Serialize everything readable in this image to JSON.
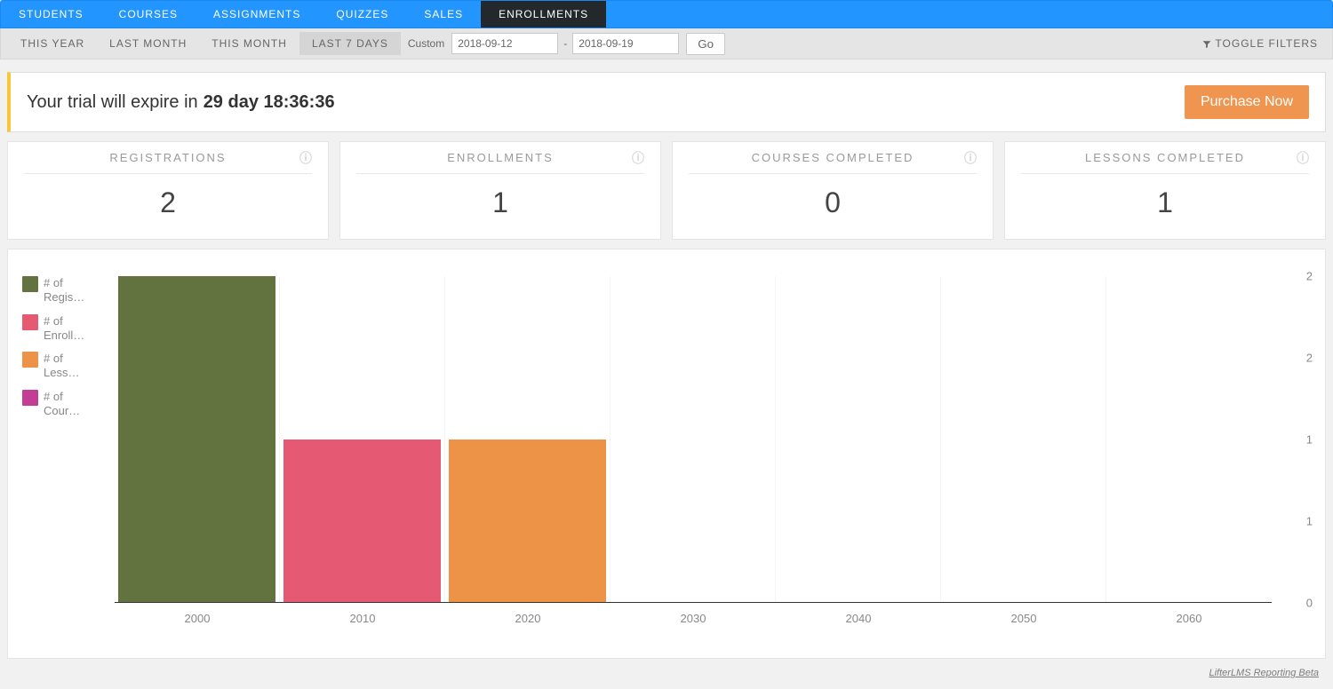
{
  "nav": {
    "tabs": [
      {
        "label": "STUDENTS",
        "active": false
      },
      {
        "label": "COURSES",
        "active": false
      },
      {
        "label": "ASSIGNMENTS",
        "active": false
      },
      {
        "label": "QUIZZES",
        "active": false
      },
      {
        "label": "SALES",
        "active": false
      },
      {
        "label": "ENROLLMENTS",
        "active": true
      }
    ]
  },
  "subbar": {
    "ranges": [
      {
        "label": "THIS YEAR",
        "active": false
      },
      {
        "label": "LAST MONTH",
        "active": false
      },
      {
        "label": "THIS MONTH",
        "active": false
      },
      {
        "label": "LAST 7 DAYS",
        "active": true
      }
    ],
    "custom_label": "Custom",
    "date_from": "2018-09-12",
    "date_to": "2018-09-19",
    "go_label": "Go",
    "toggle_filters_label": "TOGGLE FILTERS"
  },
  "trial": {
    "prefix": "Your trial will expire in",
    "countdown": "29 day 18:36:36",
    "purchase_label": "Purchase Now"
  },
  "stats": [
    {
      "title": "REGISTRATIONS",
      "value": "2"
    },
    {
      "title": "ENROLLMENTS",
      "value": "1"
    },
    {
      "title": "COURSES COMPLETED",
      "value": "0"
    },
    {
      "title": "LESSONS COMPLETED",
      "value": "1"
    }
  ],
  "chart_data": {
    "type": "bar",
    "series": [
      {
        "name": "# of\nRegis…",
        "legend_full": "# of Registrations",
        "color": "#62733f"
      },
      {
        "name": "# of\nEnroll…",
        "legend_full": "# of Enrollments",
        "color": "#e55973"
      },
      {
        "name": "# of\nLess…",
        "legend_full": "# of Lessons",
        "color": "#ed9348"
      },
      {
        "name": "# of\nCour…",
        "legend_full": "# of Courses",
        "color": "#c33d94"
      }
    ],
    "bars": [
      {
        "x": "2000",
        "series": 0,
        "value": 2,
        "hpct": 100
      },
      {
        "x": "2010",
        "series": 1,
        "value": 1,
        "hpct": 50
      },
      {
        "x": "2020",
        "series": 2,
        "value": 1,
        "hpct": 50
      }
    ],
    "x_ticks": [
      "2000",
      "2010",
      "2020",
      "2030",
      "2040",
      "2050",
      "2060"
    ],
    "y_ticks": [
      {
        "label": "2",
        "pos_pct": 0
      },
      {
        "label": "2",
        "pos_pct": 25
      },
      {
        "label": "1",
        "pos_pct": 50
      },
      {
        "label": "1",
        "pos_pct": 75
      },
      {
        "label": "0",
        "pos_pct": 100
      }
    ],
    "ylim": [
      0,
      2
    ]
  },
  "footer": {
    "link": "LifterLMS Reporting Beta"
  }
}
